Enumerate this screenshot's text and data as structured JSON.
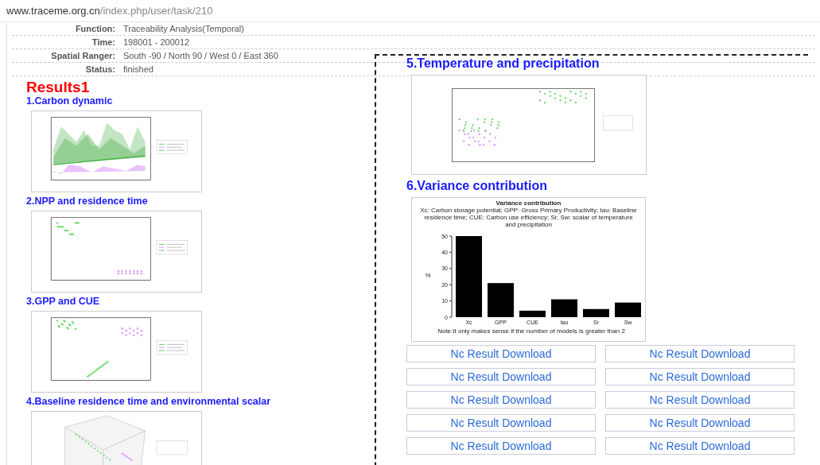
{
  "address_bar": {
    "domain": "www.traceme.org.cn",
    "path": "/index.php/user/task/210"
  },
  "task_info": [
    {
      "label": "Function:",
      "value": "Traceability Analysis(Temporal)"
    },
    {
      "label": "Time:",
      "value": "198001 - 200012"
    },
    {
      "label": "Spatial Ranger:",
      "value": "South -90 / North 90 / West 0 / East 360"
    },
    {
      "label": "Status:",
      "value": "finished"
    }
  ],
  "results_title": "Results1",
  "left_sections": [
    {
      "heading": "1.Carbon dynamic",
      "kind": "area"
    },
    {
      "heading": "2.NPP and residence time",
      "kind": "scatter"
    },
    {
      "heading": "3.GPP and CUE",
      "kind": "scatter2"
    },
    {
      "heading": "4.Baseline residence time and environmental scalar",
      "kind": "perspective"
    }
  ],
  "right_sections": [
    {
      "heading": "5.Temperature and precipitation",
      "kind": "plot"
    },
    {
      "heading": "6.Variance contribution",
      "kind": "chart",
      "chart_data": {
        "type": "bar",
        "title": "Variance contribution",
        "subtitle": "Xc: Carbon storage potential; GPP: Gross Primary Productivity; tau: Baseline residence time; CUE: Carbon use efficiency; Sr, Sw: scalar of temperature and precipitation",
        "ylabel": "%",
        "categories": [
          "Xc",
          "GPP",
          "CUE",
          "tau",
          "Sr",
          "Sw"
        ],
        "values": [
          50,
          21,
          4,
          11,
          5,
          9
        ],
        "ylim": [
          0,
          50
        ],
        "yticks": [
          0,
          10,
          20,
          30,
          40,
          50
        ],
        "annotations": [
          "Note:It only makes sense if the number of models is greater than 2"
        ]
      }
    }
  ],
  "download_buttons": [
    "Nc Result Download",
    "Nc Result Download",
    "Nc Result Download",
    "Nc Result Download",
    "Nc Result Download",
    "Nc Result Download",
    "Nc Result Download",
    "Nc Result Download",
    "Nc Result Download",
    "Nc Result Download"
  ]
}
